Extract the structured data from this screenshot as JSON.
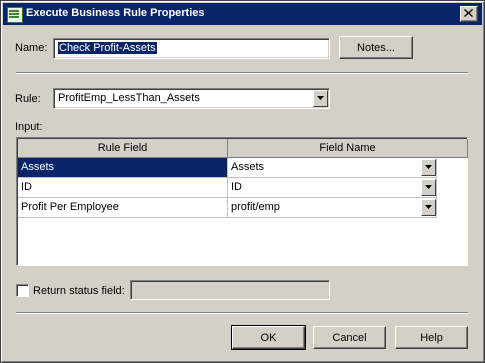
{
  "window": {
    "title": "Execute Business Rule Properties",
    "icon": "rule-dialog-icon",
    "close_icon": "close-icon"
  },
  "name_field": {
    "label": "Name:",
    "value": "Check Profit-Assets"
  },
  "notes_button": {
    "label": "Notes..."
  },
  "rule_field": {
    "label": "Rule:",
    "selected": "ProfitEmp_LessThan_Assets"
  },
  "input_section": {
    "label": "Input:",
    "columns": [
      "Rule Field",
      "Field Name"
    ],
    "rows": [
      {
        "rule_field": "Assets",
        "field_name": "Assets",
        "selected": true
      },
      {
        "rule_field": "ID",
        "field_name": "ID",
        "selected": false
      },
      {
        "rule_field": "Profit Per Employee",
        "field_name": "profit/emp",
        "selected": false
      }
    ]
  },
  "return_status": {
    "label": "Return status field:",
    "checked": false,
    "value": ""
  },
  "buttons": {
    "ok": "OK",
    "cancel": "Cancel",
    "help": "Help"
  },
  "colors": {
    "title_bar": "#0a246a",
    "dialog_bg": "#d4d0c8",
    "selection": "#0a246a"
  }
}
